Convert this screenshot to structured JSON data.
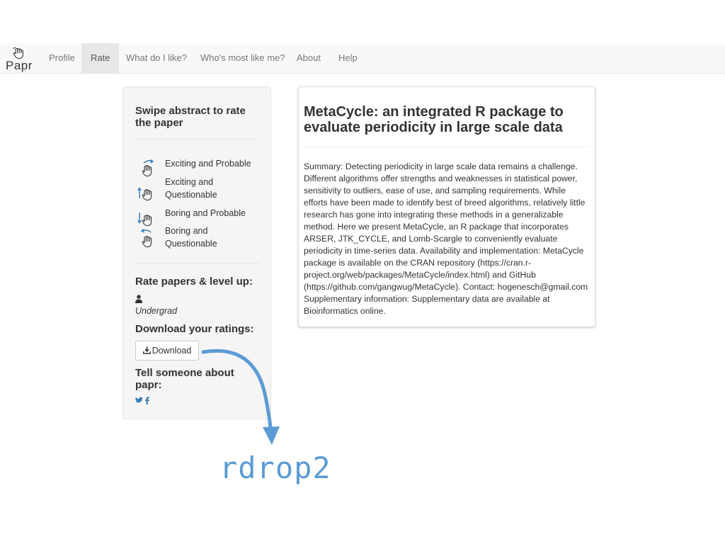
{
  "brand": {
    "name": "Papr",
    "icon": "hand-icon"
  },
  "nav": {
    "items": [
      {
        "label": "Profile",
        "active": false
      },
      {
        "label": "Rate",
        "active": true
      },
      {
        "label": "What do I like?",
        "active": false
      },
      {
        "label": "Who's most like me?",
        "active": false
      },
      {
        "label": "About",
        "active": false
      },
      {
        "label": "Help",
        "active": false
      }
    ]
  },
  "sidebar": {
    "title": "Swipe abstract to rate the paper",
    "gestures": [
      {
        "icon": "swipe-right-icon",
        "label": "Exciting and Probable"
      },
      {
        "icon": "swipe-up-icon",
        "label": "Exciting and Questionable"
      },
      {
        "icon": "swipe-down-icon",
        "label": "Boring and Probable"
      },
      {
        "icon": "swipe-left-icon",
        "label": "Boring and Questionable"
      }
    ],
    "level_heading": "Rate papers & level up:",
    "level": "Undergrad",
    "download_heading": "Download your ratings:",
    "download_button": "Download",
    "share_heading": "Tell someone about papr:",
    "social": [
      "twitter-icon",
      "facebook-icon"
    ]
  },
  "paper": {
    "title": "MetaCycle: an integrated R package to evaluate periodicity in large scale data",
    "abstract": "Summary: Detecting periodicity in large scale data remains a challenge. Different algorithms offer strengths and weaknesses in statistical power, sensitivity to outliers, ease of use, and sampling requirements. While efforts have been made to identify best of breed algorithms, relatively little research has gone into integrating these methods in a generalizable method. Here we present MetaCycle, an R package that incorporates ARSER, JTK_CYCLE, and Lomb-Scargle to conveniently evaluate periodicity in time-series data. Availability and implementation: MetaCycle package is available on the CRAN repository (https://cran.r-project.org/web/packages/MetaCycle/index.html) and GitHub (https://github.com/gangwug/MetaCycle). Contact: hogenesch@gmail.com Supplementary information: Supplementary data are available at Bioinformatics online."
  },
  "annotation": {
    "text": "rdrop2",
    "color": "#5b9bd5"
  }
}
